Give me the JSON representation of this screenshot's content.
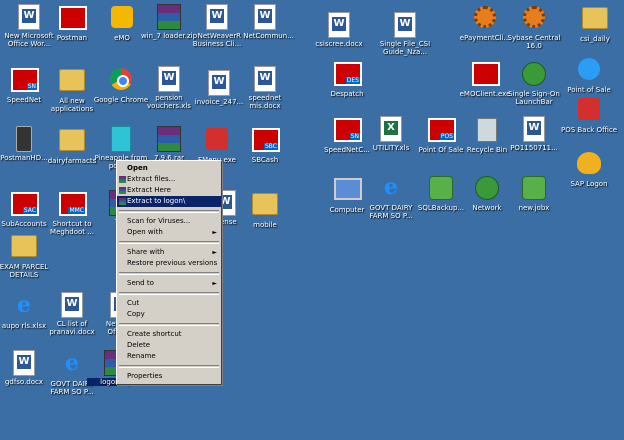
{
  "desktop": {
    "icons": [
      {
        "id": "new-ms-office",
        "label": "New Microsoft Office Wor...",
        "kind": "doc"
      },
      {
        "id": "postman",
        "label": "Postman",
        "kind": "mail"
      },
      {
        "id": "emo",
        "label": "eMO",
        "kind": "toy"
      },
      {
        "id": "win7-loader",
        "label": "win_7 loader.zip",
        "kind": "rar"
      },
      {
        "id": "netweaver",
        "label": "NetWeaver Business Cli...",
        "kind": "doc"
      },
      {
        "id": "r-netcommun",
        "label": "R NetCommun...",
        "kind": "doc"
      },
      {
        "id": "speednet",
        "label": "SpeedNet",
        "kind": "mail",
        "tag": "SN"
      },
      {
        "id": "all-new-apps",
        "label": "All new applications",
        "kind": "folder"
      },
      {
        "id": "google-chrome",
        "label": "Google Chrome",
        "kind": "chrome"
      },
      {
        "id": "pension-vouchers",
        "label": "pension vouchers.xls",
        "kind": "doc"
      },
      {
        "id": "invoice",
        "label": "invoice_247...",
        "kind": "doc"
      },
      {
        "id": "speednet-mis",
        "label": "speednet mis.docx",
        "kind": "doc"
      },
      {
        "id": "postmanhd",
        "label": "PostmanHD...",
        "kind": "phone"
      },
      {
        "id": "dairyfarmacts",
        "label": "dairyfarmacts",
        "kind": "folder"
      },
      {
        "id": "pineapple",
        "label": "Pineapple from poup...",
        "kind": "cyan"
      },
      {
        "id": "rar-796",
        "label": "7.9.6.rar",
        "kind": "rar"
      },
      {
        "id": "fmenu",
        "label": "FMenu.exe",
        "kind": "red"
      },
      {
        "id": "sbcash",
        "label": "SBCash",
        "kind": "mail",
        "tag": "SBC"
      },
      {
        "id": "subaccounts",
        "label": "SubAccounts",
        "kind": "mail",
        "tag": "SAC"
      },
      {
        "id": "shortcut-meghdoot",
        "label": "Shortcut to Meghdoot ...",
        "kind": "mail",
        "tag": "MMC"
      },
      {
        "id": "tr",
        "label": "Tr...",
        "kind": "rar"
      },
      {
        "id": "license",
        "label": "...ense",
        "kind": "doc"
      },
      {
        "id": "mobile",
        "label": "mobile",
        "kind": "folder"
      },
      {
        "id": "exam-parcel",
        "label": "EXAM PARCEL DETAILS",
        "kind": "folder"
      },
      {
        "id": "aupo-rls",
        "label": "aupo rls.xlsx",
        "kind": "ie"
      },
      {
        "id": "cl-list",
        "label": "CL list of pranavi.docx",
        "kind": "doc"
      },
      {
        "id": "new-m",
        "label": "New M... Office...",
        "kind": "doc"
      },
      {
        "id": "gdfso",
        "label": "gdfso.docx",
        "kind": "doc"
      },
      {
        "id": "govt-dairy-1",
        "label": "GOVT DAIRY FARM SO P...",
        "kind": "ie"
      },
      {
        "id": "logon-zip",
        "label": "logon.zip",
        "kind": "rar"
      },
      {
        "id": "csiscree",
        "label": "csiscree.docx",
        "kind": "doc"
      },
      {
        "id": "single-file-csi",
        "label": "Single File_CSI Guide_Nza...",
        "kind": "doc"
      },
      {
        "id": "epaymentcli",
        "label": "ePaymentCli...",
        "kind": "gear"
      },
      {
        "id": "sybase-central",
        "label": "Sybase Central 16.0",
        "kind": "gear"
      },
      {
        "id": "csi-daily",
        "label": "csi_daily",
        "kind": "folder"
      },
      {
        "id": "despatch",
        "label": "Despatch",
        "kind": "mail",
        "tag": "DES"
      },
      {
        "id": "emoclient",
        "label": "eMOClient.exe",
        "kind": "mail"
      },
      {
        "id": "sso-launchbar",
        "label": "Single Sign-On LaunchBar",
        "kind": "net"
      },
      {
        "id": "point-of-sale-1",
        "label": "Point of Sale",
        "kind": "blue"
      },
      {
        "id": "pos-back-office",
        "label": "POS Back Office",
        "kind": "red"
      },
      {
        "id": "speednetc",
        "label": "SpeedNetC...",
        "kind": "mail",
        "tag": "SN"
      },
      {
        "id": "utility-xls",
        "label": "UTILITY.xls",
        "kind": "xls"
      },
      {
        "id": "point-of-sale-2",
        "label": "Point Of Sale",
        "kind": "mail",
        "tag": "POS"
      },
      {
        "id": "recycle-bin",
        "label": "Recycle Bin",
        "kind": "bin"
      },
      {
        "id": "po1150711",
        "label": "PO1150711...",
        "kind": "doc"
      },
      {
        "id": "sap-logon",
        "label": "SAP Logon",
        "kind": "sap"
      },
      {
        "id": "computer",
        "label": "Computer",
        "kind": "pc"
      },
      {
        "id": "govt-dairy-2",
        "label": "GOVT DAIRY FARM SO P...",
        "kind": "ie"
      },
      {
        "id": "sqlbackup",
        "label": "SQLBackup...",
        "kind": "disk"
      },
      {
        "id": "network",
        "label": "Network",
        "kind": "net"
      },
      {
        "id": "new-jobx",
        "label": "new.jobx",
        "kind": "disk"
      }
    ]
  },
  "context_menu": {
    "open": "Open",
    "extract_files": "Extract files...",
    "extract_here": "Extract Here",
    "extract_to": "Extract to logon\\",
    "scan": "Scan for Viruses...",
    "open_with": "Open with",
    "share_with": "Share with",
    "restore": "Restore previous versions",
    "send_to": "Send to",
    "cut": "Cut",
    "copy": "Copy",
    "create_shortcut": "Create shortcut",
    "delete": "Delete",
    "rename": "Rename",
    "properties": "Properties",
    "submenu_arrow": "►"
  },
  "colors": {
    "desktop": "#3a6ea5",
    "menu": "#d4d0c8",
    "highlight": "#0a246a"
  }
}
